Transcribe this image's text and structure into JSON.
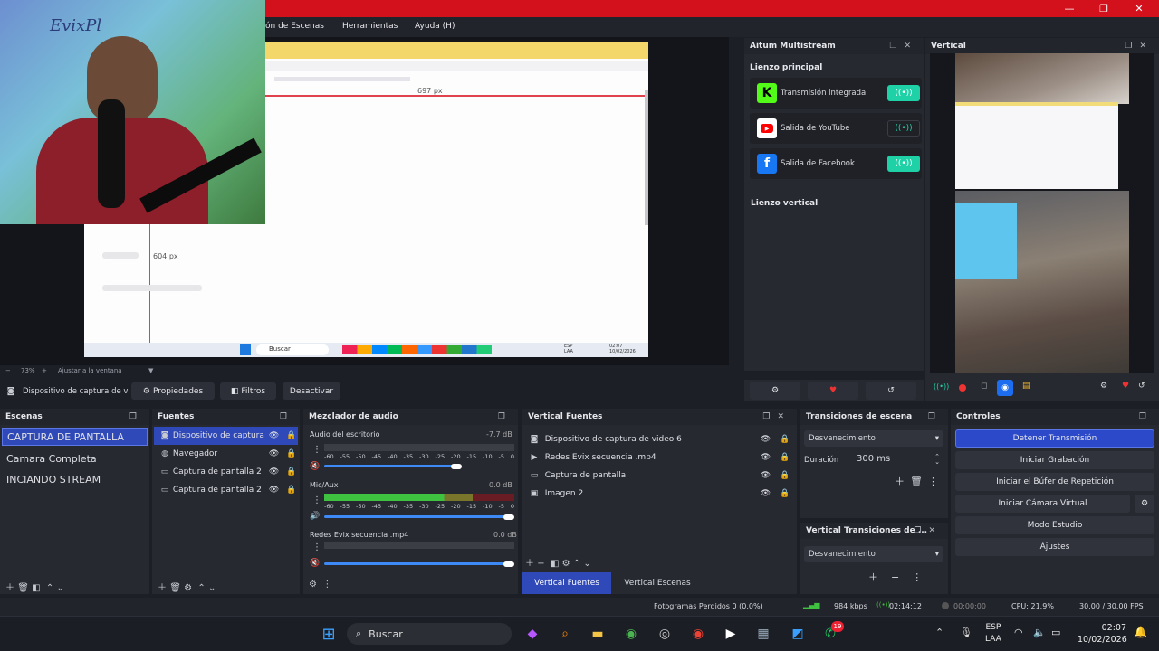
{
  "window": {
    "minimize_glyph": "—",
    "maximize_glyph": "❐",
    "close_glyph": "✕"
  },
  "menu": {
    "items": [
      "ón de Escenas",
      "Herramientas",
      "Ayuda (H)"
    ]
  },
  "preview": {
    "ruler_label_1": "697 px",
    "ruler_label_2": "604 px",
    "zoom_label": "73%",
    "fit_label": "Ajustar a la ventana",
    "webcam_overlay_text": "EvixPl",
    "inner_taskbar_search": "Buscar",
    "inner_lang": "ESP\nLAA",
    "inner_time": "02:07\n10/02/2026"
  },
  "source_toolbar": {
    "selected_source": "Dispositivo de captura de v",
    "properties_label": "Propiedades",
    "filters_label": "Filtros",
    "deactivate_label": "Desactivar"
  },
  "multistream": {
    "title": "Aitum Multistream",
    "main_canvas_label": "Lienzo principal",
    "vertical_canvas_label": "Lienzo vertical",
    "outputs": [
      {
        "name": "Transmisión integrada",
        "icon": "kick-icon",
        "color": "#53fc18",
        "active": true
      },
      {
        "name": "Salida de YouTube",
        "icon": "youtube-icon",
        "color": "#ff0000",
        "active": false
      },
      {
        "name": "Salida de Facebook",
        "icon": "facebook-icon",
        "color": "#1877f2",
        "active": true
      }
    ],
    "broadcast_glyph": "((•))",
    "accent": "#1fd1a6"
  },
  "vertical": {
    "title": "Vertical"
  },
  "scenes": {
    "title": "Escenas",
    "items": [
      "CAPTURA DE PANTALLA",
      "Camara Completa",
      "INCIANDO STREAM"
    ]
  },
  "sources": {
    "title": "Fuentes",
    "items": [
      "Dispositivo de captura de",
      "Navegador",
      "Captura de pantalla 2",
      "Captura de pantalla 2"
    ]
  },
  "mixer": {
    "title": "Mezclador de audio",
    "channels": [
      {
        "name": "Audio del escritorio",
        "db": "-7.7 dB",
        "level": 0
      },
      {
        "name": "Mic/Aux",
        "db": "0.0 dB",
        "level": 0.64
      },
      {
        "name": "Redes Evix secuencia .mp4",
        "db": "0.0 dB",
        "level": 0
      }
    ],
    "ticks": [
      "-60",
      "-55",
      "-50",
      "-45",
      "-40",
      "-35",
      "-30",
      "-25",
      "-20",
      "-15",
      "-10",
      "-5",
      "0"
    ]
  },
  "vsources": {
    "title": "Vertical Fuentes",
    "items": [
      {
        "name": "Dispositivo de captura de video 6",
        "icon": "camera-icon"
      },
      {
        "name": "Redes Evix secuencia .mp4",
        "icon": "play-icon"
      },
      {
        "name": "Captura de pantalla",
        "icon": "monitor-icon"
      },
      {
        "name": "Imagen 2",
        "icon": "image-icon"
      }
    ],
    "tab_sources": "Vertical Fuentes",
    "tab_scenes": "Vertical Escenas"
  },
  "transitions": {
    "title": "Transiciones de escena",
    "type": "Desvanecimiento",
    "duration_label": "Duración",
    "duration_value": "300 ms"
  },
  "vtransitions": {
    "title": "Vertical Transiciones de ...",
    "type": "Desvanecimiento"
  },
  "controls": {
    "title": "Controles",
    "buttons": [
      "Detener Transmisión",
      "Iniciar Grabación",
      "Iniciar el Búfer de Repetición",
      "Iniciar Cámara Virtual",
      "Modo Estudio",
      "Ajustes"
    ],
    "primary_color": "#2b49c9"
  },
  "status": {
    "dropped": "Fotogramas Perdidos 0 (0.0%)",
    "bitrate": "984 kbps",
    "stream_time": "02:14:12",
    "rec_time": "00:00:00",
    "cpu": "CPU: 21.9%",
    "fps": "30.00 / 30.00 FPS"
  },
  "taskbar": {
    "search_label": "Buscar",
    "lang_line1": "ESP",
    "lang_line2": "LAA",
    "time": "02:07",
    "date": "10/02/2026",
    "whatsapp_badge": "19"
  }
}
